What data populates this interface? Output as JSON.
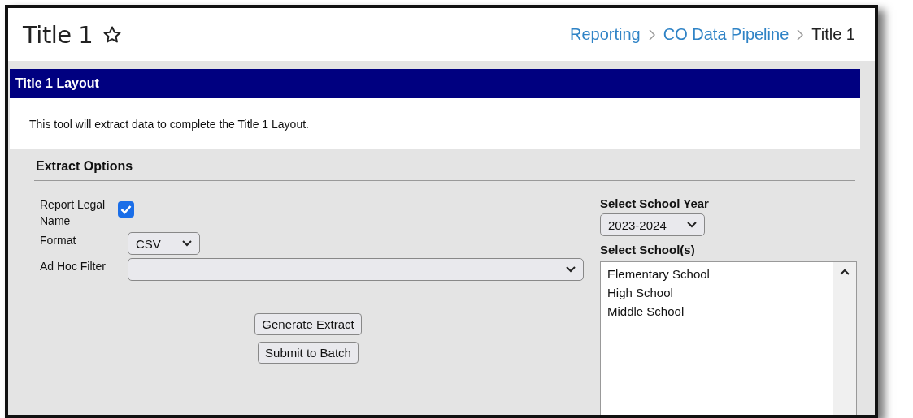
{
  "header": {
    "title": "Title 1",
    "breadcrumbs": [
      {
        "label": "Reporting",
        "link": true
      },
      {
        "label": "CO Data Pipeline",
        "link": true
      },
      {
        "label": "Title 1",
        "link": false
      }
    ]
  },
  "section_bar": {
    "title": "Title 1 Layout"
  },
  "description": "This tool will extract data to complete the Title 1 Layout.",
  "extract_options": {
    "heading": "Extract Options",
    "report_legal_name": {
      "label": "Report Legal Name",
      "checked": true
    },
    "format": {
      "label": "Format",
      "value": "CSV"
    },
    "ad_hoc_filter": {
      "label": "Ad Hoc Filter"
    },
    "buttons": [
      "Generate Extract",
      "Submit to Batch"
    ],
    "school_year": {
      "label": "Select School Year",
      "value": "2023-2024"
    },
    "schools": {
      "label": "Select School(s)",
      "items": [
        {
          "label": "Elementary School",
          "selected": false
        },
        {
          "label": "High School",
          "selected": false
        },
        {
          "label": "Middle School",
          "selected": false
        }
      ]
    }
  }
}
